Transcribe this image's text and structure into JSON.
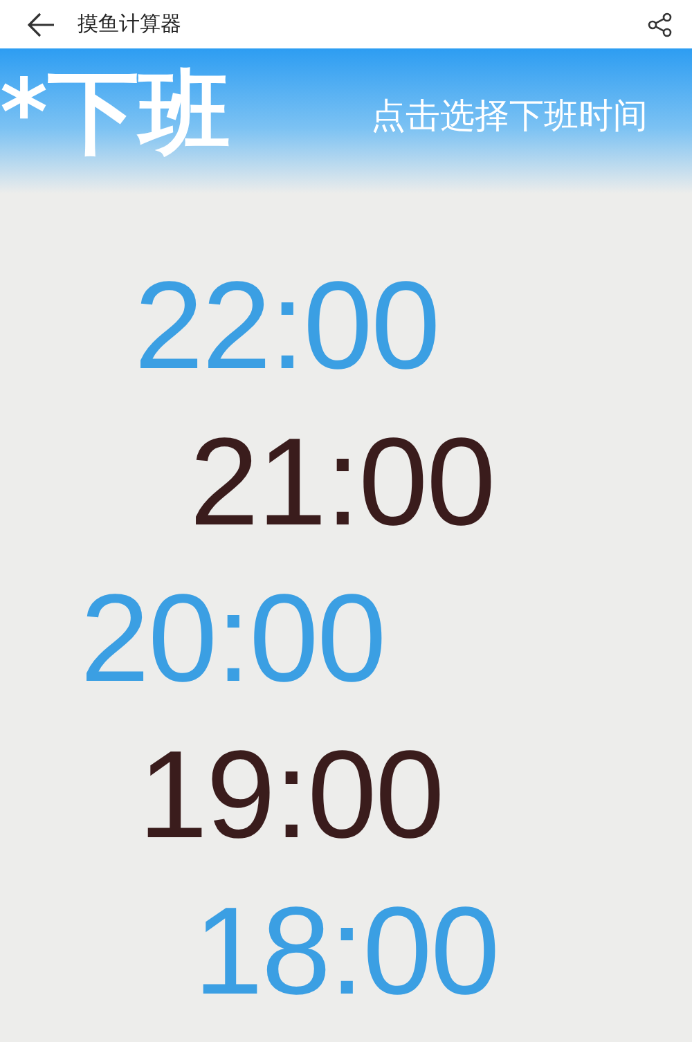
{
  "top_bar": {
    "title": "摸鱼计算器"
  },
  "banner": {
    "title": "*下班",
    "hint": "点击选择下班时间"
  },
  "times": [
    {
      "label": "22:00",
      "color": "#3b9fe3"
    },
    {
      "label": "21:00",
      "color": "#3a1c1c"
    },
    {
      "label": "20:00",
      "color": "#3b9fe3"
    },
    {
      "label": "19:00",
      "color": "#3a1c1c"
    },
    {
      "label": "18:00",
      "color": "#3b9fe3"
    }
  ]
}
